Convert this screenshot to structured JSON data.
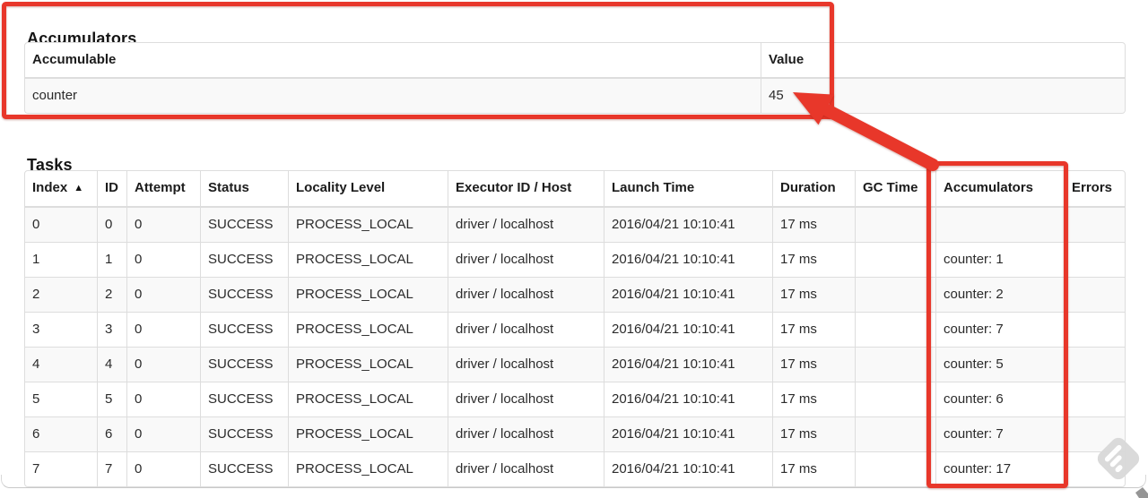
{
  "accumulators_section": {
    "title": "Accumulators",
    "table": {
      "columns": [
        {
          "key": "accumulable",
          "label": "Accumulable"
        },
        {
          "key": "value",
          "label": "Value"
        }
      ],
      "rows": [
        {
          "accumulable": "counter",
          "value": "45"
        }
      ]
    }
  },
  "tasks_section": {
    "title": "Tasks",
    "table": {
      "sort_icon": "▲",
      "columns": [
        {
          "key": "index",
          "label": "Index",
          "sort": true
        },
        {
          "key": "id",
          "label": "ID"
        },
        {
          "key": "attempt",
          "label": "Attempt"
        },
        {
          "key": "status",
          "label": "Status"
        },
        {
          "key": "locality",
          "label": "Locality Level"
        },
        {
          "key": "executor",
          "label": "Executor ID / Host"
        },
        {
          "key": "launch",
          "label": "Launch Time"
        },
        {
          "key": "duration",
          "label": "Duration"
        },
        {
          "key": "gc",
          "label": "GC Time"
        },
        {
          "key": "accumulators",
          "label": "Accumulators"
        },
        {
          "key": "errors",
          "label": "Errors"
        }
      ],
      "rows": [
        {
          "index": "0",
          "id": "0",
          "attempt": "0",
          "status": "SUCCESS",
          "locality": "PROCESS_LOCAL",
          "executor": "driver / localhost",
          "launch": "2016/04/21 10:10:41",
          "duration": "17 ms",
          "gc": "",
          "accumulators": "",
          "errors": ""
        },
        {
          "index": "1",
          "id": "1",
          "attempt": "0",
          "status": "SUCCESS",
          "locality": "PROCESS_LOCAL",
          "executor": "driver / localhost",
          "launch": "2016/04/21 10:10:41",
          "duration": "17 ms",
          "gc": "",
          "accumulators": "counter: 1",
          "errors": ""
        },
        {
          "index": "2",
          "id": "2",
          "attempt": "0",
          "status": "SUCCESS",
          "locality": "PROCESS_LOCAL",
          "executor": "driver / localhost",
          "launch": "2016/04/21 10:10:41",
          "duration": "17 ms",
          "gc": "",
          "accumulators": "counter: 2",
          "errors": ""
        },
        {
          "index": "3",
          "id": "3",
          "attempt": "0",
          "status": "SUCCESS",
          "locality": "PROCESS_LOCAL",
          "executor": "driver / localhost",
          "launch": "2016/04/21 10:10:41",
          "duration": "17 ms",
          "gc": "",
          "accumulators": "counter: 7",
          "errors": ""
        },
        {
          "index": "4",
          "id": "4",
          "attempt": "0",
          "status": "SUCCESS",
          "locality": "PROCESS_LOCAL",
          "executor": "driver / localhost",
          "launch": "2016/04/21 10:10:41",
          "duration": "17 ms",
          "gc": "",
          "accumulators": "counter: 5",
          "errors": ""
        },
        {
          "index": "5",
          "id": "5",
          "attempt": "0",
          "status": "SUCCESS",
          "locality": "PROCESS_LOCAL",
          "executor": "driver / localhost",
          "launch": "2016/04/21 10:10:41",
          "duration": "17 ms",
          "gc": "",
          "accumulators": "counter: 6",
          "errors": ""
        },
        {
          "index": "6",
          "id": "6",
          "attempt": "0",
          "status": "SUCCESS",
          "locality": "PROCESS_LOCAL",
          "executor": "driver / localhost",
          "launch": "2016/04/21 10:10:41",
          "duration": "17 ms",
          "gc": "",
          "accumulators": "counter: 7",
          "errors": ""
        },
        {
          "index": "7",
          "id": "7",
          "attempt": "0",
          "status": "SUCCESS",
          "locality": "PROCESS_LOCAL",
          "executor": "driver / localhost",
          "launch": "2016/04/21 10:10:41",
          "duration": "17 ms",
          "gc": "",
          "accumulators": "counter: 17",
          "errors": ""
        }
      ]
    }
  },
  "annotations": {
    "color": "#e8372a",
    "watermark_color": "#d9d9d9"
  }
}
